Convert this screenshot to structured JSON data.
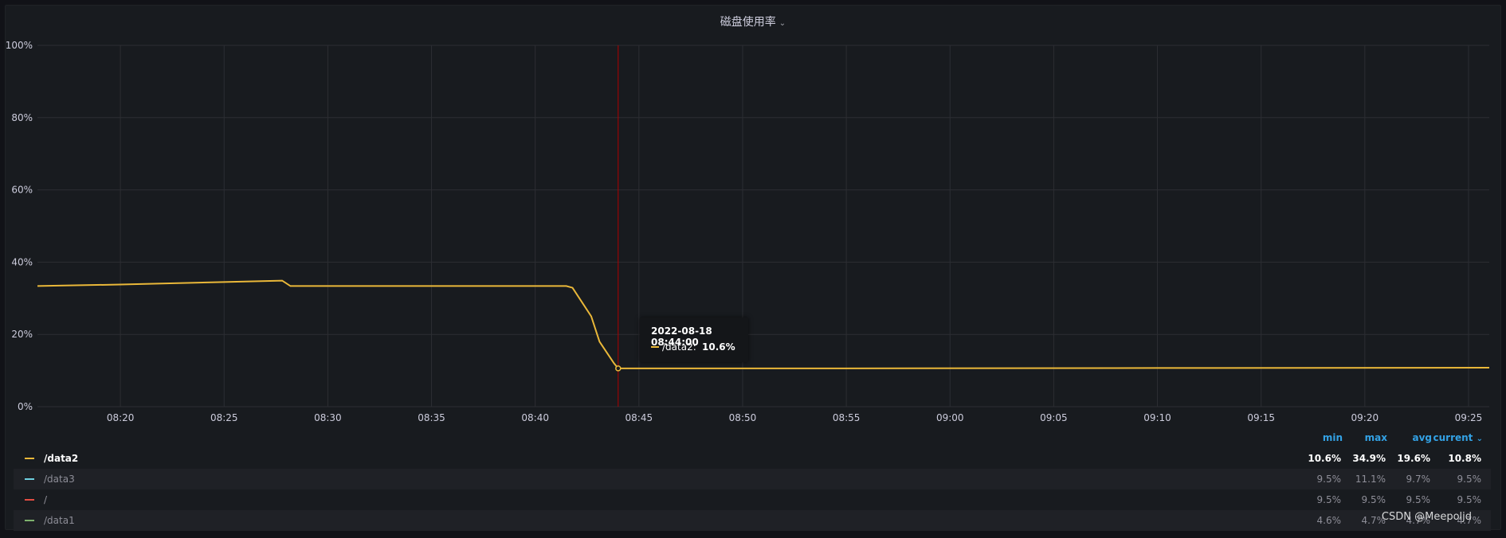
{
  "panel": {
    "title": "磁盘使用率"
  },
  "chart_data": {
    "type": "line",
    "title": "磁盘使用率",
    "ylim": [
      0,
      100
    ],
    "y_ticks": [
      "0%",
      "20%",
      "40%",
      "60%",
      "80%",
      "100%"
    ],
    "x_range_minutes": [
      "08:16",
      "09:26"
    ],
    "x_ticks": [
      "08:20",
      "08:25",
      "08:30",
      "08:35",
      "08:40",
      "08:45",
      "08:50",
      "08:55",
      "09:00",
      "09:05",
      "09:10",
      "09:15",
      "09:20",
      "09:25"
    ],
    "grid": true,
    "legend_placement": "bottom",
    "series": [
      {
        "name": "/data2",
        "color": "#eab839",
        "points": [
          [
            "08:16",
            33.4
          ],
          [
            "08:20",
            33.8
          ],
          [
            "08:25",
            34.5
          ],
          [
            "08:27.8",
            34.9
          ],
          [
            "08:28.2",
            33.4
          ],
          [
            "08:35",
            33.4
          ],
          [
            "08:41.5",
            33.4
          ],
          [
            "08:41.8",
            32.9
          ],
          [
            "08:42.7",
            25.0
          ],
          [
            "08:43.1",
            18.0
          ],
          [
            "08:43.8",
            12.0
          ],
          [
            "08:44",
            10.6
          ],
          [
            "08:55",
            10.6
          ],
          [
            "09:10",
            10.7
          ],
          [
            "09:26",
            10.8
          ]
        ]
      }
    ]
  },
  "tooltip": {
    "time": "2022-08-18 08:44:00",
    "series": "/data2:",
    "value": "10.6%",
    "x": "08:44",
    "y": 10.6
  },
  "legend": {
    "headers": {
      "min": "min",
      "max": "max",
      "avg": "avg",
      "current": "current"
    },
    "rows": [
      {
        "name": "/data2",
        "color": "#eab839",
        "min": "10.6%",
        "max": "34.9%",
        "avg": "19.6%",
        "current": "10.8%",
        "active": true
      },
      {
        "name": "/data3",
        "color": "#6ed0e0",
        "min": "9.5%",
        "max": "11.1%",
        "avg": "9.7%",
        "current": "9.5%",
        "active": false
      },
      {
        "name": "/",
        "color": "#e24d42",
        "min": "9.5%",
        "max": "9.5%",
        "avg": "9.5%",
        "current": "9.5%",
        "active": false
      },
      {
        "name": "/data1",
        "color": "#7eb26d",
        "min": "4.6%",
        "max": "4.7%",
        "avg": "4.7%",
        "current": "4.7%",
        "active": false
      }
    ]
  },
  "watermark": "CSDN @Meepoljd"
}
